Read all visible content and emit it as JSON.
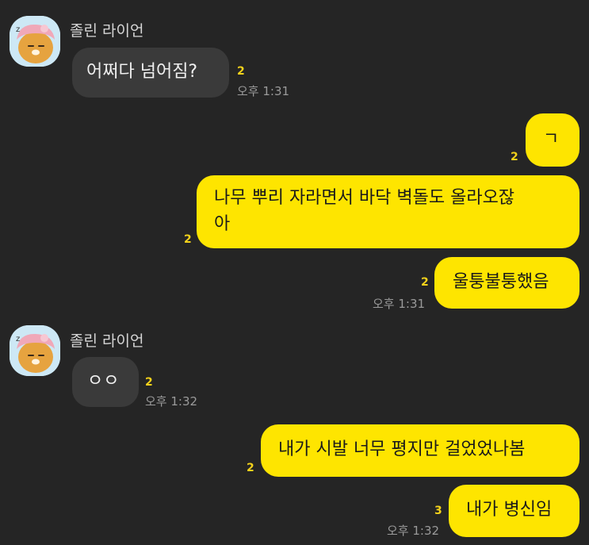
{
  "contact": {
    "name": "졸린 라이언",
    "avatar_icon": "ryan-sleeping-avatar-icon"
  },
  "colors": {
    "background": "#252525",
    "incoming_bubble": "#3a3a3a",
    "outgoing_bubble": "#fee500",
    "unread_count": "#f3d21b"
  },
  "messages": [
    {
      "text": "어쩌다 넘어짐?",
      "unread": "2",
      "time": "오후 1:31"
    },
    {
      "text": "ㄱ",
      "unread": "2"
    },
    {
      "line1": "나무 뿌리 자라면서 바닥 벽돌도 올라오잖",
      "line2": "아",
      "unread": "2"
    },
    {
      "text": "울퉁불퉁했음",
      "unread": "2",
      "time": "오후 1:31"
    },
    {
      "text": "ㅇㅇ",
      "unread": "2",
      "time": "오후 1:32"
    },
    {
      "text": "내가 시발 너무 평지만 걸었었나봄",
      "unread": "2"
    },
    {
      "text": "내가 병신임",
      "unread": "3",
      "time": "오후 1:32"
    }
  ]
}
